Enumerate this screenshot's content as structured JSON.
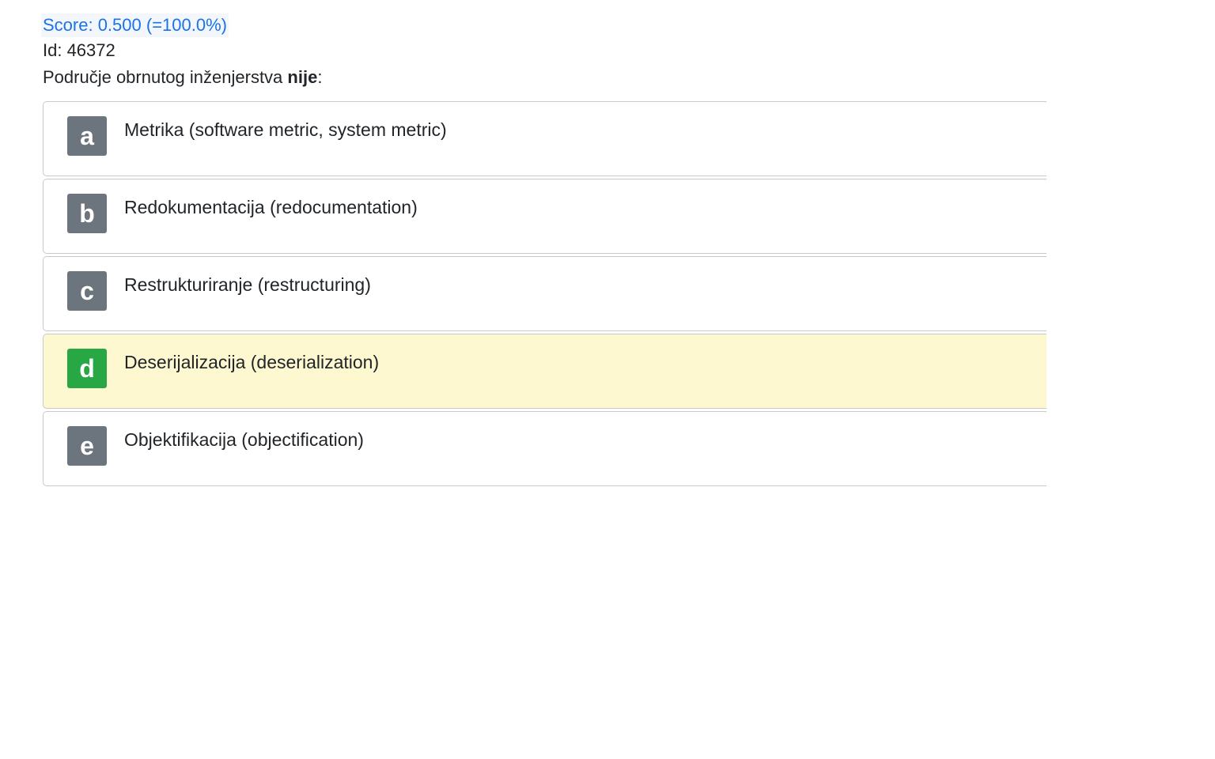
{
  "header": {
    "score": "Score: 0.500 (=100.0%)",
    "id_label": "Id: 46372",
    "question_prefix": "Područje obrnutog inženjerstva ",
    "question_bold": "nije",
    "question_suffix": ":"
  },
  "options": [
    {
      "letter": "a",
      "text": "Metrika (software metric, system metric)",
      "selected": false
    },
    {
      "letter": "b",
      "text": "Redokumentacija (redocumentation)",
      "selected": false
    },
    {
      "letter": "c",
      "text": "Restrukturiranje (restructuring)",
      "selected": false
    },
    {
      "letter": "d",
      "text": "Deserijalizacija (deserialization)",
      "selected": true
    },
    {
      "letter": "e",
      "text": "Objektifikacija (objectification)",
      "selected": false
    }
  ],
  "colors": {
    "score_text": "#1a73e8",
    "badge_default": "#6c757d",
    "badge_selected": "#28a745",
    "selected_background": "#fdf8cf"
  }
}
